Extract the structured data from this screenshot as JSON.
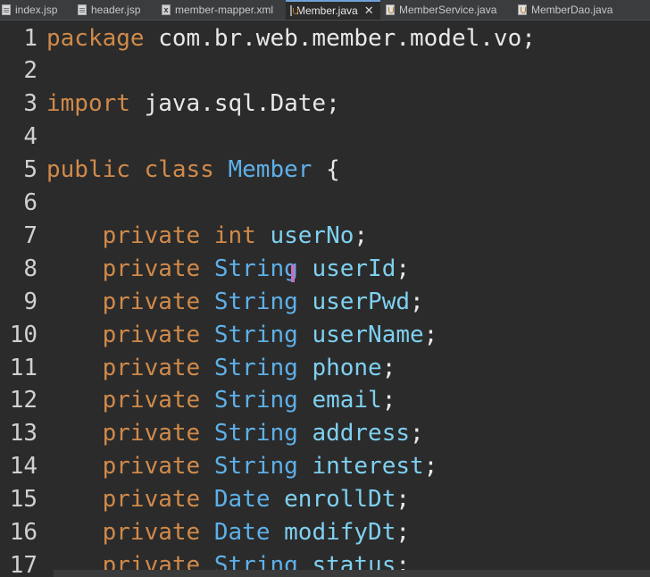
{
  "tabs": [
    {
      "label": "index.jsp",
      "icon": "file-icon",
      "active": false
    },
    {
      "label": "header.jsp",
      "icon": "file-icon",
      "active": false
    },
    {
      "label": "member-mapper.xml",
      "icon": "xml-file-icon",
      "active": false
    },
    {
      "label": "Member.java",
      "icon": "java-file-icon",
      "active": true,
      "close": "✕"
    },
    {
      "label": "MemberService.java",
      "icon": "java-file-icon",
      "active": false
    },
    {
      "label": "MemberDao.java",
      "icon": "java-file-icon",
      "active": false
    }
  ],
  "code_lines": [
    {
      "n": "1",
      "tokens": [
        [
          "kw",
          "package"
        ],
        [
          "txt",
          " com.br.web.member.model.vo;"
        ]
      ]
    },
    {
      "n": "2",
      "tokens": []
    },
    {
      "n": "3",
      "tokens": [
        [
          "kw",
          "import"
        ],
        [
          "txt",
          " java.sql.Date;"
        ]
      ]
    },
    {
      "n": "4",
      "tokens": []
    },
    {
      "n": "5",
      "tokens": [
        [
          "kw",
          "public class "
        ],
        [
          "cls",
          "Member"
        ],
        [
          "txt",
          " {"
        ]
      ]
    },
    {
      "n": "6",
      "tokens": []
    },
    {
      "n": "7",
      "tokens": [
        [
          "txt",
          "    "
        ],
        [
          "kw",
          "private int "
        ],
        [
          "fld",
          "userNo"
        ],
        [
          "txt",
          ";"
        ]
      ]
    },
    {
      "n": "8",
      "tokens": [
        [
          "txt",
          "    "
        ],
        [
          "kw",
          "private "
        ],
        [
          "ty",
          "String "
        ],
        [
          "fld",
          "userId"
        ],
        [
          "txt",
          ";"
        ]
      ]
    },
    {
      "n": "9",
      "tokens": [
        [
          "txt",
          "    "
        ],
        [
          "kw",
          "private "
        ],
        [
          "ty",
          "String "
        ],
        [
          "fld",
          "userPwd"
        ],
        [
          "txt",
          ";"
        ]
      ]
    },
    {
      "n": "10",
      "tokens": [
        [
          "txt",
          "    "
        ],
        [
          "kw",
          "private "
        ],
        [
          "ty",
          "String "
        ],
        [
          "fld",
          "userName"
        ],
        [
          "txt",
          ";"
        ]
      ]
    },
    {
      "n": "11",
      "tokens": [
        [
          "txt",
          "    "
        ],
        [
          "kw",
          "private "
        ],
        [
          "ty",
          "String "
        ],
        [
          "fld",
          "phone"
        ],
        [
          "txt",
          ";"
        ]
      ]
    },
    {
      "n": "12",
      "tokens": [
        [
          "txt",
          "    "
        ],
        [
          "kw",
          "private "
        ],
        [
          "ty",
          "String "
        ],
        [
          "fld",
          "email"
        ],
        [
          "txt",
          ";"
        ]
      ]
    },
    {
      "n": "13",
      "tokens": [
        [
          "txt",
          "    "
        ],
        [
          "kw",
          "private "
        ],
        [
          "ty",
          "String "
        ],
        [
          "fld",
          "address"
        ],
        [
          "txt",
          ";"
        ]
      ]
    },
    {
      "n": "14",
      "tokens": [
        [
          "txt",
          "    "
        ],
        [
          "kw",
          "private "
        ],
        [
          "ty",
          "String "
        ],
        [
          "fld",
          "interest"
        ],
        [
          "txt",
          ";"
        ]
      ]
    },
    {
      "n": "15",
      "tokens": [
        [
          "txt",
          "    "
        ],
        [
          "kw",
          "private "
        ],
        [
          "ty",
          "Date "
        ],
        [
          "fld",
          "enrollDt"
        ],
        [
          "txt",
          ";"
        ]
      ]
    },
    {
      "n": "16",
      "tokens": [
        [
          "txt",
          "    "
        ],
        [
          "kw",
          "private "
        ],
        [
          "ty",
          "Date "
        ],
        [
          "fld",
          "modifyDt"
        ],
        [
          "txt",
          ";"
        ]
      ]
    },
    {
      "n": "17",
      "tokens": [
        [
          "txt",
          "    "
        ],
        [
          "kw",
          "private "
        ],
        [
          "ty",
          "String "
        ],
        [
          "fld",
          "status"
        ],
        [
          "txt",
          ";"
        ]
      ]
    }
  ]
}
